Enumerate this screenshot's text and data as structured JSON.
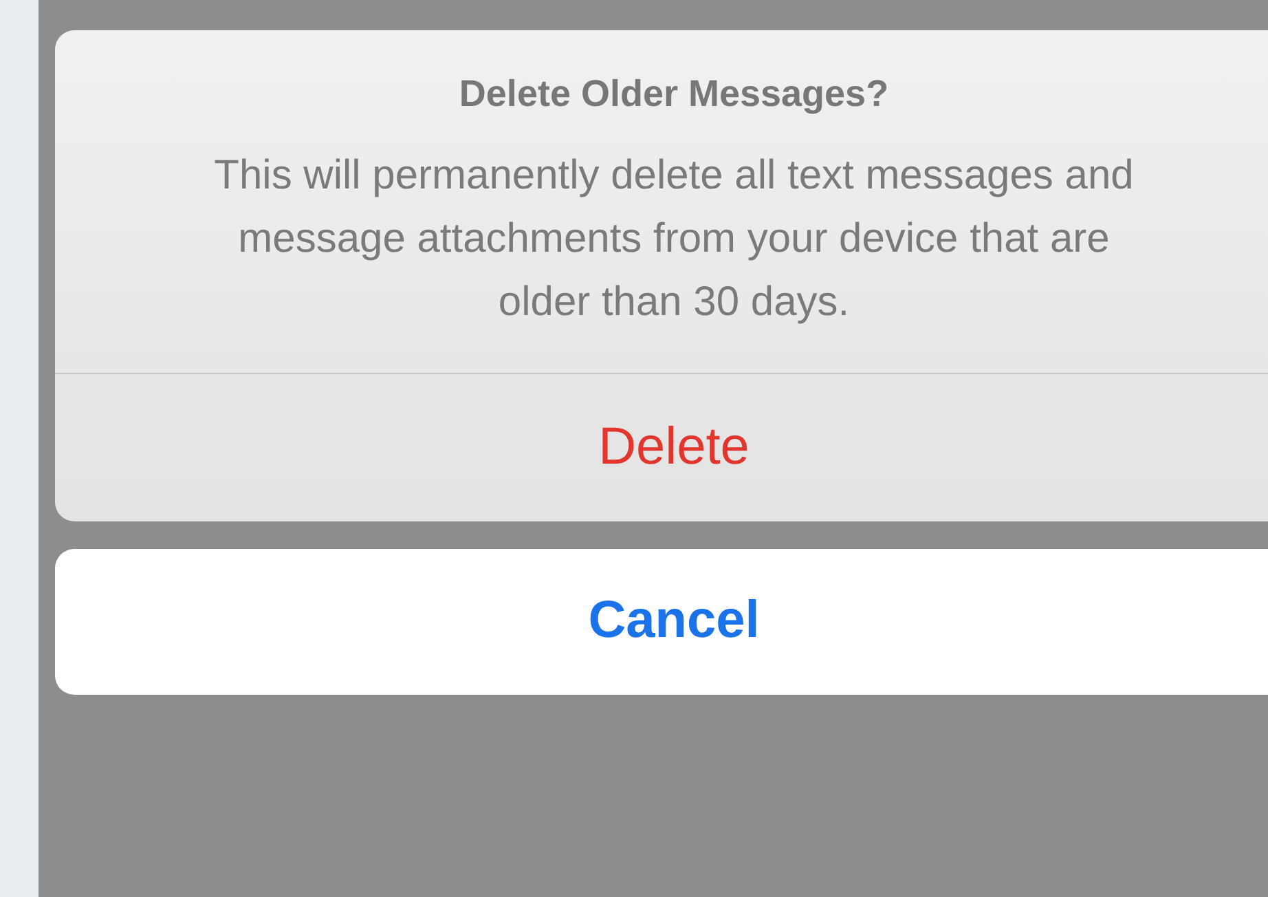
{
  "alert": {
    "title": "Delete Older Messages?",
    "message": "This will permanently delete all text messages and message attachments from your device that are older than 30 days."
  },
  "actions": [
    {
      "label": "Delete",
      "kind": "destructive"
    }
  ],
  "cancel": {
    "label": "Cancel"
  }
}
